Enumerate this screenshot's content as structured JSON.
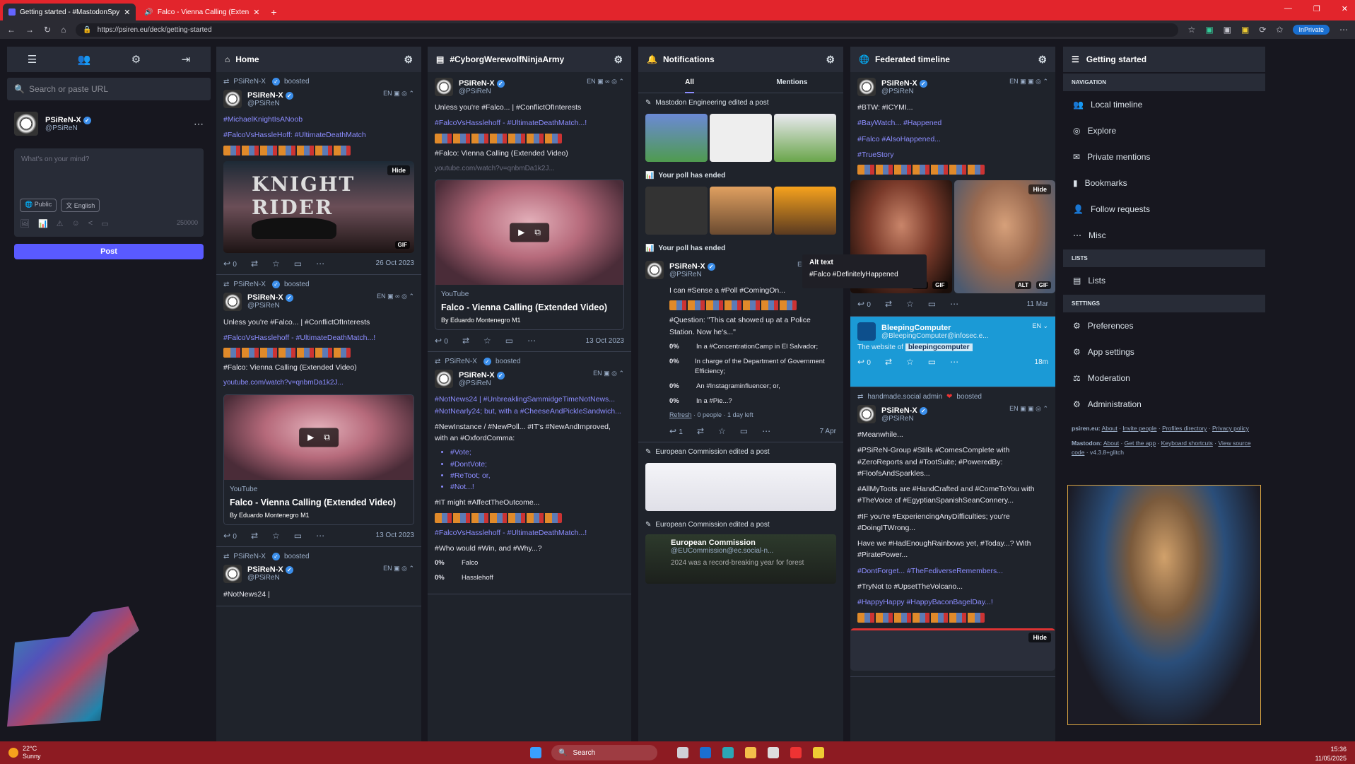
{
  "browser": {
    "tab1": "Getting started - #MastodonSpy",
    "tab2": "Falco - Vienna Calling (Exten",
    "url": "https://psiren.eu/deck/getting-started",
    "inprivate": "InPrivate"
  },
  "compose": {
    "search_placeholder": "Search or paste URL",
    "account_name": "PSiReN-X",
    "account_handle": "@PSiReN",
    "placeholder": "What's on your mind?",
    "visibility": "Public",
    "language": "English",
    "char_count": "250000",
    "post_label": "Post"
  },
  "home": {
    "title": "Home",
    "s1": {
      "booster": "PSiReN-X",
      "boosted": "boosted",
      "name": "PSiReN-X",
      "handle": "@PSiReN",
      "lang": "EN",
      "line1": "#MichaelKnightIsANoob",
      "line2": "#FalcoVsHassleHoff: #UltimateDeathMatch",
      "media_title": "KNIGHT RIDER",
      "hide": "Hide",
      "gif": "GIF",
      "reply": "0",
      "date": "26 Oct 2023"
    },
    "s2": {
      "booster": "PSiReN-X",
      "boosted": "boosted",
      "name": "PSiReN-X",
      "handle": "@PSiReN",
      "lang": "EN",
      "line1": "Unless you're #Falco... | #ConflictOfInterests",
      "line2": "#FalcoVsHasslehoff - #UltimateDeathMatch...!",
      "line3": "#Falco: Vienna Calling (Extended Video)",
      "link": "youtube.com/watch?v=qnbmDa1k2J...",
      "card_source": "YouTube",
      "card_title": "Falco - Vienna Calling (Extended Video)",
      "card_author": "By Eduardo Montenegro M1",
      "reply": "0",
      "date": "13 Oct 2023"
    },
    "s3": {
      "booster": "PSiReN-X",
      "boosted": "boosted",
      "name": "PSiReN-X",
      "handle": "@PSiReN",
      "lang": "EN",
      "line1": "#NotNews24 |"
    }
  },
  "hashtag": {
    "title": "#CyborgWerewolfNinjaArmy",
    "s1": {
      "name": "PSiReN-X",
      "handle": "@PSiReN",
      "lang": "EN",
      "line1": "Unless you're #Falco... | #ConflictOfInterests",
      "line2": "#FalcoVsHasslehoff - #UltimateDeathMatch...!",
      "line3": "#Falco: Vienna Calling (Extended Video)",
      "link": "youtube.com/watch?v=qnbmDa1k2J...",
      "card_source": "YouTube",
      "card_title": "Falco - Vienna Calling (Extended Video)",
      "card_author": "By Eduardo Montenegro M1",
      "reply": "0",
      "date": "13 Oct 2023"
    },
    "s2": {
      "booster": "PSiReN-X",
      "boosted": "boosted",
      "name": "PSiReN-X",
      "handle": "@PSiReN",
      "lang": "EN",
      "line1": "#NotNews24 | #UnbreaklingSammidgeTimeNotNews... #NotNearly24; but, with a #CheeseAndPickleSandwich...",
      "line2": "#NewInstance / #NewPoll... #IT's #NewAndImproved, with an #OxfordComma:",
      "li1": "#Vote;",
      "li2": "#DontVote;",
      "li3": "#ReToot; or,",
      "li4": "#Not...!",
      "line3": "#IT might #AffectTheOutcome...",
      "line4": "#FalcoVsHasslehoff - #UltimateDeathMatch...!",
      "line5": "#Who would #Win, and #Why...?",
      "p1_pct": "0%",
      "p1_label": "Falco",
      "p2_pct": "0%",
      "p2_label": "Hasslehoff"
    }
  },
  "notifications": {
    "title": "Notifications",
    "tab_all": "All",
    "tab_mentions": "Mentions",
    "n1": "Mastodon Engineering edited a post",
    "n2": "Your poll has ended",
    "n3": "Your poll has ended",
    "poll": {
      "name": "PSiReN-X",
      "handle": "@PSiReN",
      "lang": "EN",
      "line1": "I can #Sense a #Poll #ComingOn...",
      "line2": "#Question: \"This cat showed up at a Police Station. Now he's...\"",
      "o1_pct": "0%",
      "o1": "In a #ConcentrationCamp in El Salvador;",
      "o2_pct": "0%",
      "o2": "In charge of the Department of Government Efficiency;",
      "o3_pct": "0%",
      "o3": "An #Instagraminfluencer; or,",
      "o4_pct": "0%",
      "o4": "In a #Pie...?",
      "refresh": "Refresh",
      "meta": "· 0 people · 1 day left",
      "reply": "1",
      "date": "7 Apr"
    },
    "n4": "European Commission edited a post",
    "n5": "European Commission edited a post",
    "ec_name": "European Commission",
    "ec_handle": "@EUCommission@ec.social-n...",
    "ec_text": "2024 was a record-breaking year for forest"
  },
  "tooltip": {
    "title": "Alt text",
    "text": "#Falco #DefinitelyHappened"
  },
  "federated": {
    "title": "Federated timeline",
    "s1": {
      "name": "PSiReN-X",
      "handle": "@PSiReN",
      "lang": "EN",
      "line1": "#BTW: #ICYMI...",
      "line2": "#BayWatch... #Happened",
      "line3": "#Falco #AlsoHappened...",
      "line4": "#TrueStory",
      "hide": "Hide",
      "alt": "ALT",
      "gif": "GIF",
      "reply": "0",
      "date": "11 Mar"
    },
    "s2": {
      "name": "BleepingComputer",
      "handle": "@BleepingComputer@infosec.e...",
      "lang": "EN",
      "preview": "The website of",
      "logo": "bleepingcomputer",
      "reply": "0",
      "date": "18m"
    },
    "s3": {
      "booster": "handmade.social admin",
      "boosted": "boosted",
      "name": "PSiReN-X",
      "handle": "@PSiReN",
      "lang": "EN",
      "line1": "#Meanwhile...",
      "line2": "#PSiReN-Group #Stills #ComesComplete with #ZeroReports and #TootSuite; #PoweredBy: #FloofsAndSparkles...",
      "line3": "#AllMyToots are #HandCrafted and #ComeToYou with #TheVoice of #EgyptianSpanishSeanConnery...",
      "line4": "#IF you're #ExperiencingAnyDifficulties; you're #DoingITWrong...",
      "line5": "Have we #HadEnoughRainbows yet, #Today...? With #PiratePower...",
      "line6": "#DontForget... #TheFediverseRemembers...",
      "line7": "#TryNot to #UpsetTheVolcano...",
      "line8": "#HappyHappy #HappyBaconBagelDay...!",
      "hide": "Hide"
    }
  },
  "nav": {
    "title": "Getting started",
    "sect_navigation": "NAVIGATION",
    "local": "Local timeline",
    "explore": "Explore",
    "private": "Private mentions",
    "bookmarks": "Bookmarks",
    "follow": "Follow requests",
    "misc": "Misc",
    "sect_lists": "LISTS",
    "lists": "Lists",
    "sect_settings": "SETTINGS",
    "preferences": "Preferences",
    "app_settings": "App settings",
    "moderation": "Moderation",
    "administration": "Administration",
    "footer1_site": "psiren.eu:",
    "footer1_about": "About",
    "footer1_invite": "Invite people",
    "footer1_profiles": "Profiles directory",
    "footer1_privacy": "Privacy policy",
    "footer2_site": "Mastodon:",
    "footer2_about": "About",
    "footer2_app": "Get the app",
    "footer2_keys": "Keyboard shortcuts",
    "footer2_source": "View source code",
    "footer2_version": "v4.3.8+glitch"
  },
  "taskbar": {
    "temp": "22°C",
    "weather": "Sunny",
    "search": "Search",
    "time": "15:36",
    "date": "11/05/2025"
  }
}
